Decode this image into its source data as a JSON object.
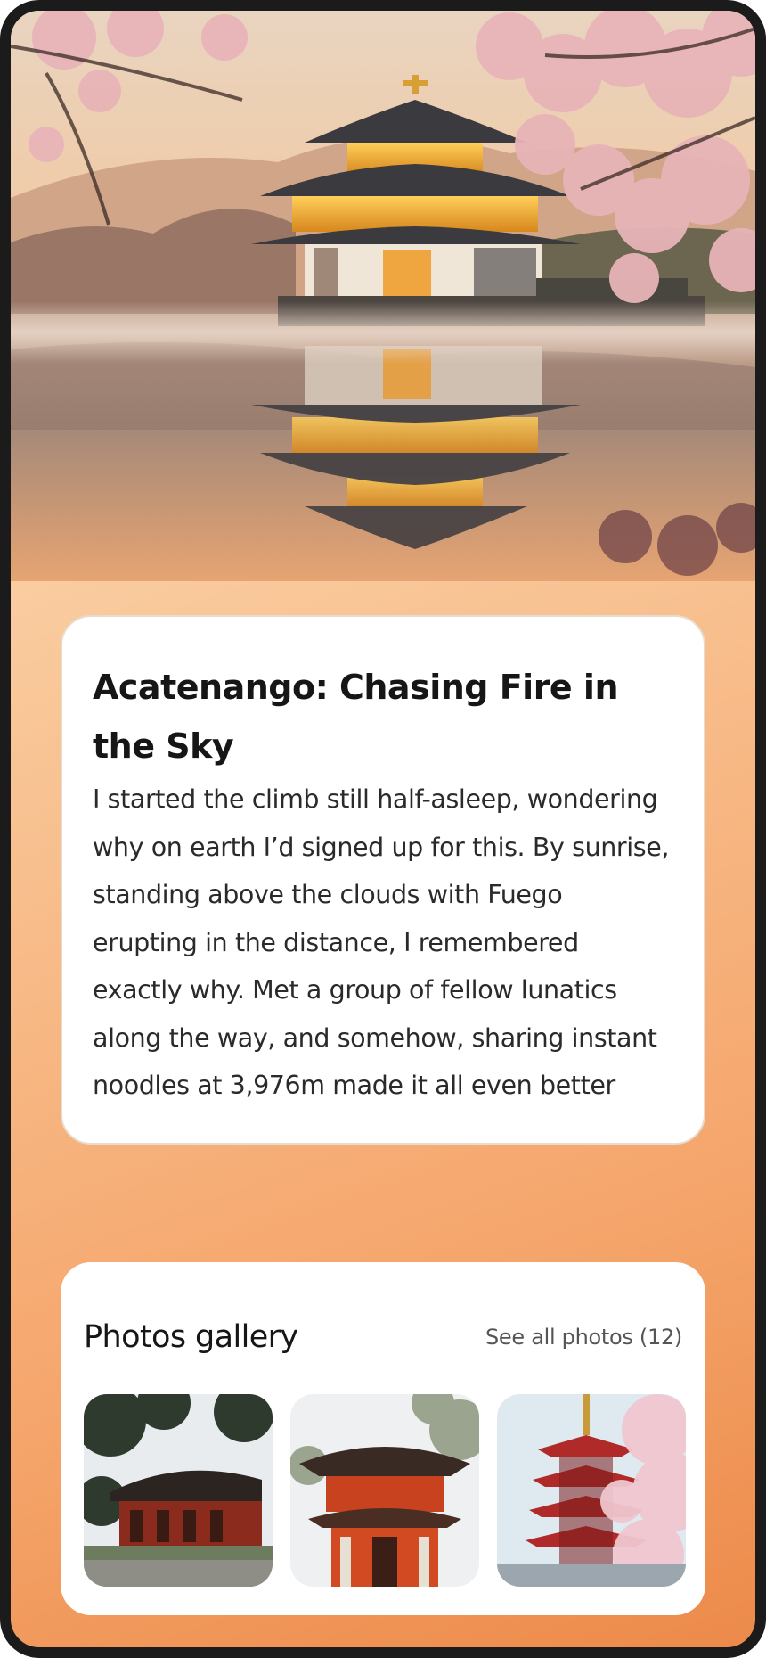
{
  "story": {
    "title": "Acatenango: Chasing Fire in the Sky",
    "body": "I started the climb still half-asleep, wondering why on earth I’d signed up for this. By sunrise, standing above the clouds with Fuego erupting in the distance, I remembered exactly why. Met a group of fellow lunatics along the way, and somehow, sharing instant noodles at 3,976m made it all even better"
  },
  "gallery": {
    "title": "Photos gallery",
    "see_all_label": "See all photos (12)",
    "photos": [
      {
        "subject": "wooden-temple-photo"
      },
      {
        "subject": "red-gate-photo"
      },
      {
        "subject": "pagoda-cherry-blossom-photo"
      }
    ]
  },
  "colors": {
    "background_top": "#fde6c9",
    "background_bottom": "#ec8a4a",
    "card": "#ffffff",
    "text_primary": "#161616",
    "text_secondary": "#555555",
    "frame": "#1b1b1b"
  }
}
